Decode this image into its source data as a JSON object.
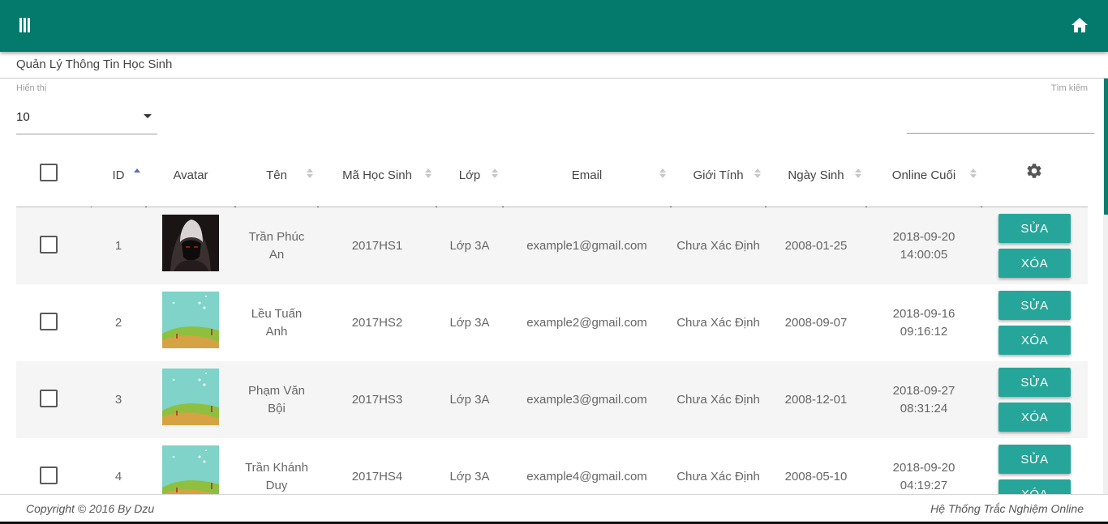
{
  "colors": {
    "header_bg": "#047a6d",
    "button_bg": "#26a69a",
    "row_shade": "#f5f5f5",
    "sort_active": "#5c6bc0"
  },
  "topbar": {
    "menu_icon": "menu-bars-icon",
    "home_icon": "home-icon"
  },
  "page": {
    "title": "Quản Lý Thông Tin Học Sinh"
  },
  "controls": {
    "show_label": "Hiển thị",
    "show_value": "10",
    "search_label": "Tìm kiếm",
    "search_value": ""
  },
  "table": {
    "headers": {
      "id": "ID",
      "avatar": "Avatar",
      "name": "Tên",
      "code": "Mã Học Sinh",
      "class": "Lớp",
      "email": "Email",
      "gender": "Giới Tính",
      "birthday": "Ngày Sinh",
      "last_online": "Online Cuối",
      "settings_icon": "gear-icon"
    },
    "sorted_column": "id",
    "rows": [
      {
        "id": "1",
        "avatar": "dark-hooded-figure",
        "name_line1": "Trần Phúc",
        "name_line2": "An",
        "code": "2017HS1",
        "class": "Lớp 3A",
        "email": "example1@gmail.com",
        "gender": "Chưa Xác Định",
        "birthday": "2008-01-25",
        "online_date": "2018-09-20",
        "online_time": "14:00:05",
        "edit": "SỬA",
        "delete": "XÓA"
      },
      {
        "id": "2",
        "avatar": "landscape-default",
        "name_line1": "Lều Tuấn",
        "name_line2": "Anh",
        "code": "2017HS2",
        "class": "Lớp 3A",
        "email": "example2@gmail.com",
        "gender": "Chưa Xác Định",
        "birthday": "2008-09-07",
        "online_date": "2018-09-16",
        "online_time": "09:16:12",
        "edit": "SỬA",
        "delete": "XÓA"
      },
      {
        "id": "3",
        "avatar": "landscape-default",
        "name_line1": "Phạm Văn",
        "name_line2": "Bội",
        "code": "2017HS3",
        "class": "Lớp 3A",
        "email": "example3@gmail.com",
        "gender": "Chưa Xác Định",
        "birthday": "2008-12-01",
        "online_date": "2018-09-27",
        "online_time": "08:31:24",
        "edit": "SỬA",
        "delete": "XÓA"
      },
      {
        "id": "4",
        "avatar": "landscape-default",
        "name_line1": "Trần Khánh",
        "name_line2": "Duy",
        "code": "2017HS4",
        "class": "Lớp 3A",
        "email": "example4@gmail.com",
        "gender": "Chưa Xác Định",
        "birthday": "2008-05-10",
        "online_date": "2018-09-20",
        "online_time": "04:19:27",
        "edit": "SỬA",
        "delete": "XÓA"
      }
    ]
  },
  "footer": {
    "copyright": "Copyright © 2016 By Dzu",
    "system_name": "Hệ Thống Trắc Nghiệm Online"
  }
}
